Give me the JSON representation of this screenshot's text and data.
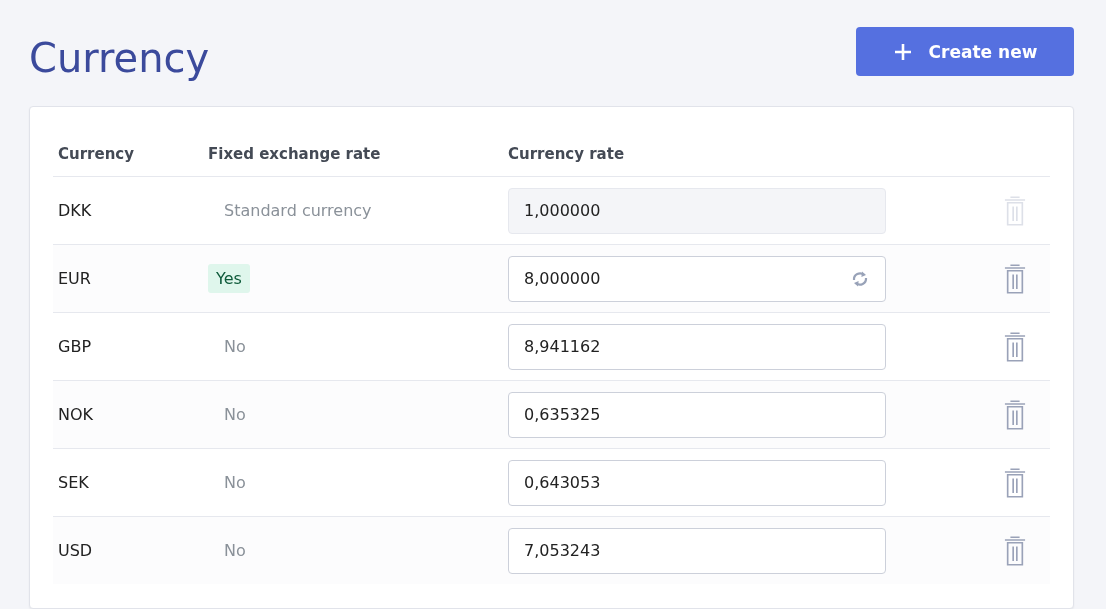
{
  "page": {
    "title": "Currency"
  },
  "create_button": {
    "label": "Create new"
  },
  "table": {
    "columns": [
      "Currency",
      "Fixed exchange rate",
      "Currency rate"
    ],
    "rows": [
      {
        "currency": "DKK",
        "fixed": {
          "kind": "standard",
          "text": "Standard currency"
        },
        "rate": "1,000000",
        "disabled": true,
        "refresh": false
      },
      {
        "currency": "EUR",
        "fixed": {
          "kind": "yes",
          "text": "Yes"
        },
        "rate": "8,000000",
        "disabled": false,
        "refresh": true
      },
      {
        "currency": "GBP",
        "fixed": {
          "kind": "no",
          "text": "No"
        },
        "rate": "8,941162",
        "disabled": false,
        "refresh": false
      },
      {
        "currency": "NOK",
        "fixed": {
          "kind": "no",
          "text": "No"
        },
        "rate": "0,635325",
        "disabled": false,
        "refresh": false
      },
      {
        "currency": "SEK",
        "fixed": {
          "kind": "no",
          "text": "No"
        },
        "rate": "0,643053",
        "disabled": false,
        "refresh": false
      },
      {
        "currency": "USD",
        "fixed": {
          "kind": "no",
          "text": "No"
        },
        "rate": "7,053243",
        "disabled": false,
        "refresh": false
      }
    ]
  }
}
